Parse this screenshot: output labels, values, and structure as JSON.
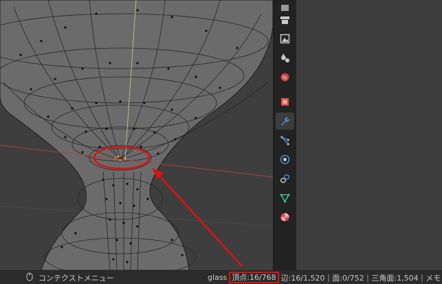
{
  "statusbar": {
    "mouse_hint": "コンテクストメニュー",
    "object_name": "glass",
    "vertices": "頂点:16/768",
    "edges": "辺:16/1,520",
    "faces": "面:0/752",
    "triangles": "三角面:1,504",
    "memory": "メモリ"
  },
  "toolbar_icons": [
    "tool-icon",
    "render-icon",
    "output-icon",
    "view-layer-icon",
    "scene-icon",
    "world-icon",
    "object-icon",
    "modifier-wrench-icon",
    "particles-icon",
    "physics-icon",
    "constraints-icon",
    "object-data-mesh-icon",
    "material-icon"
  ],
  "colors": {
    "annotation_red": "#e01010",
    "x_axis": "#b04040",
    "y_axis": "#9bb04a",
    "active_tab": "#4a8fd8"
  }
}
